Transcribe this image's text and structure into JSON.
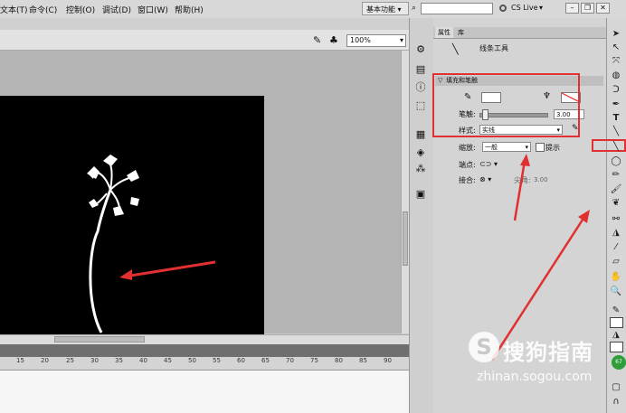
{
  "menubar": {
    "items": [
      "文本(T)",
      "命令(C)",
      "控制(O)",
      "调试(D)",
      "窗口(W)",
      "帮助(H)"
    ],
    "workspace": "基本功能",
    "cs_live": "CS Live"
  },
  "edit_bar": {
    "zoom": "100%"
  },
  "timeline": {
    "frame_numbers": [
      "15",
      "20",
      "25",
      "30",
      "35",
      "40",
      "45",
      "50",
      "55",
      "60",
      "65",
      "70",
      "75",
      "80",
      "85",
      "90"
    ]
  },
  "panel": {
    "tabs": [
      "属性",
      "库"
    ],
    "tool_name": "线条工具",
    "section_title": "填充和笔触",
    "stroke_label": "笔触:",
    "stroke_value": "3.00",
    "style_label": "样式:",
    "style_value": "实线",
    "scale_label": "缩放:",
    "scale_value": "一般",
    "hint_label": "提示",
    "cap_label": "端点:",
    "join_label": "接合:",
    "miter_label": "尖角:",
    "miter_value": "3.00"
  },
  "watermark": {
    "logo": "S",
    "text": "搜狗指南",
    "url": "zhinan.sogou.com"
  },
  "badge": "67",
  "colors": {
    "annotation": "#e03030",
    "stage": "#000000"
  }
}
